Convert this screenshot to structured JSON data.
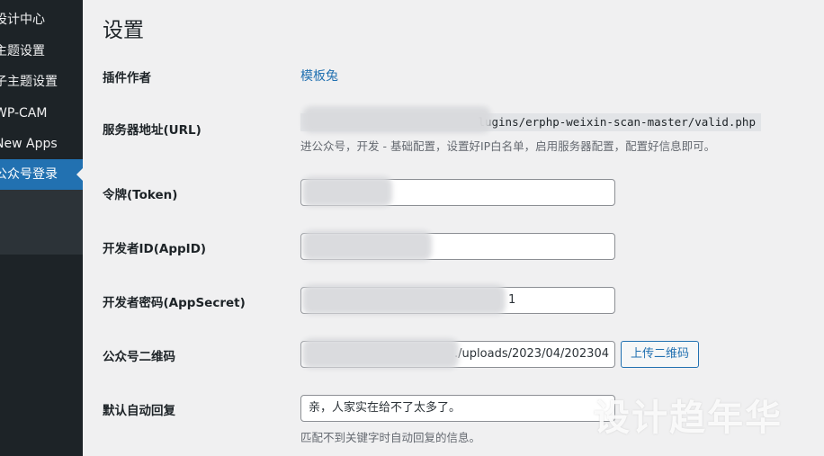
{
  "sidebar": {
    "items": [
      {
        "label": "设计中心"
      },
      {
        "label": "主题设置"
      },
      {
        "label": "子主题设置"
      },
      {
        "label": "WP-CAM"
      },
      {
        "label": "New Apps"
      },
      {
        "label": "公众号登录",
        "active": true
      }
    ],
    "colors": {
      "background": "#1d2327",
      "active": "#2271b1"
    }
  },
  "page": {
    "title": "设置"
  },
  "fields": {
    "author": {
      "label": "插件作者",
      "value": "模板兔"
    },
    "server_url": {
      "label": "服务器地址(URL)",
      "value": "lugins/erphp-weixin-scan-master/valid.php",
      "description": "进公众号，开发 - 基础配置，设置好IP白名单，启用服务器配置，配置好信息即可。"
    },
    "token": {
      "label": "令牌(Token)",
      "value": ""
    },
    "appid": {
      "label": "开发者ID(AppID)",
      "value": ""
    },
    "appsecret": {
      "label": "开发者密码(AppSecret)",
      "value": "1"
    },
    "qrcode": {
      "label": "公众号二维码",
      "value": "./uploads/2023/04/202304",
      "button": "上传二维码"
    },
    "auto_reply": {
      "label": "默认自动回复",
      "value": "亲，人家实在给不了太多了。",
      "description": "匹配不到关键字时自动回复的信息。"
    }
  },
  "watermark": "设计趋年华"
}
